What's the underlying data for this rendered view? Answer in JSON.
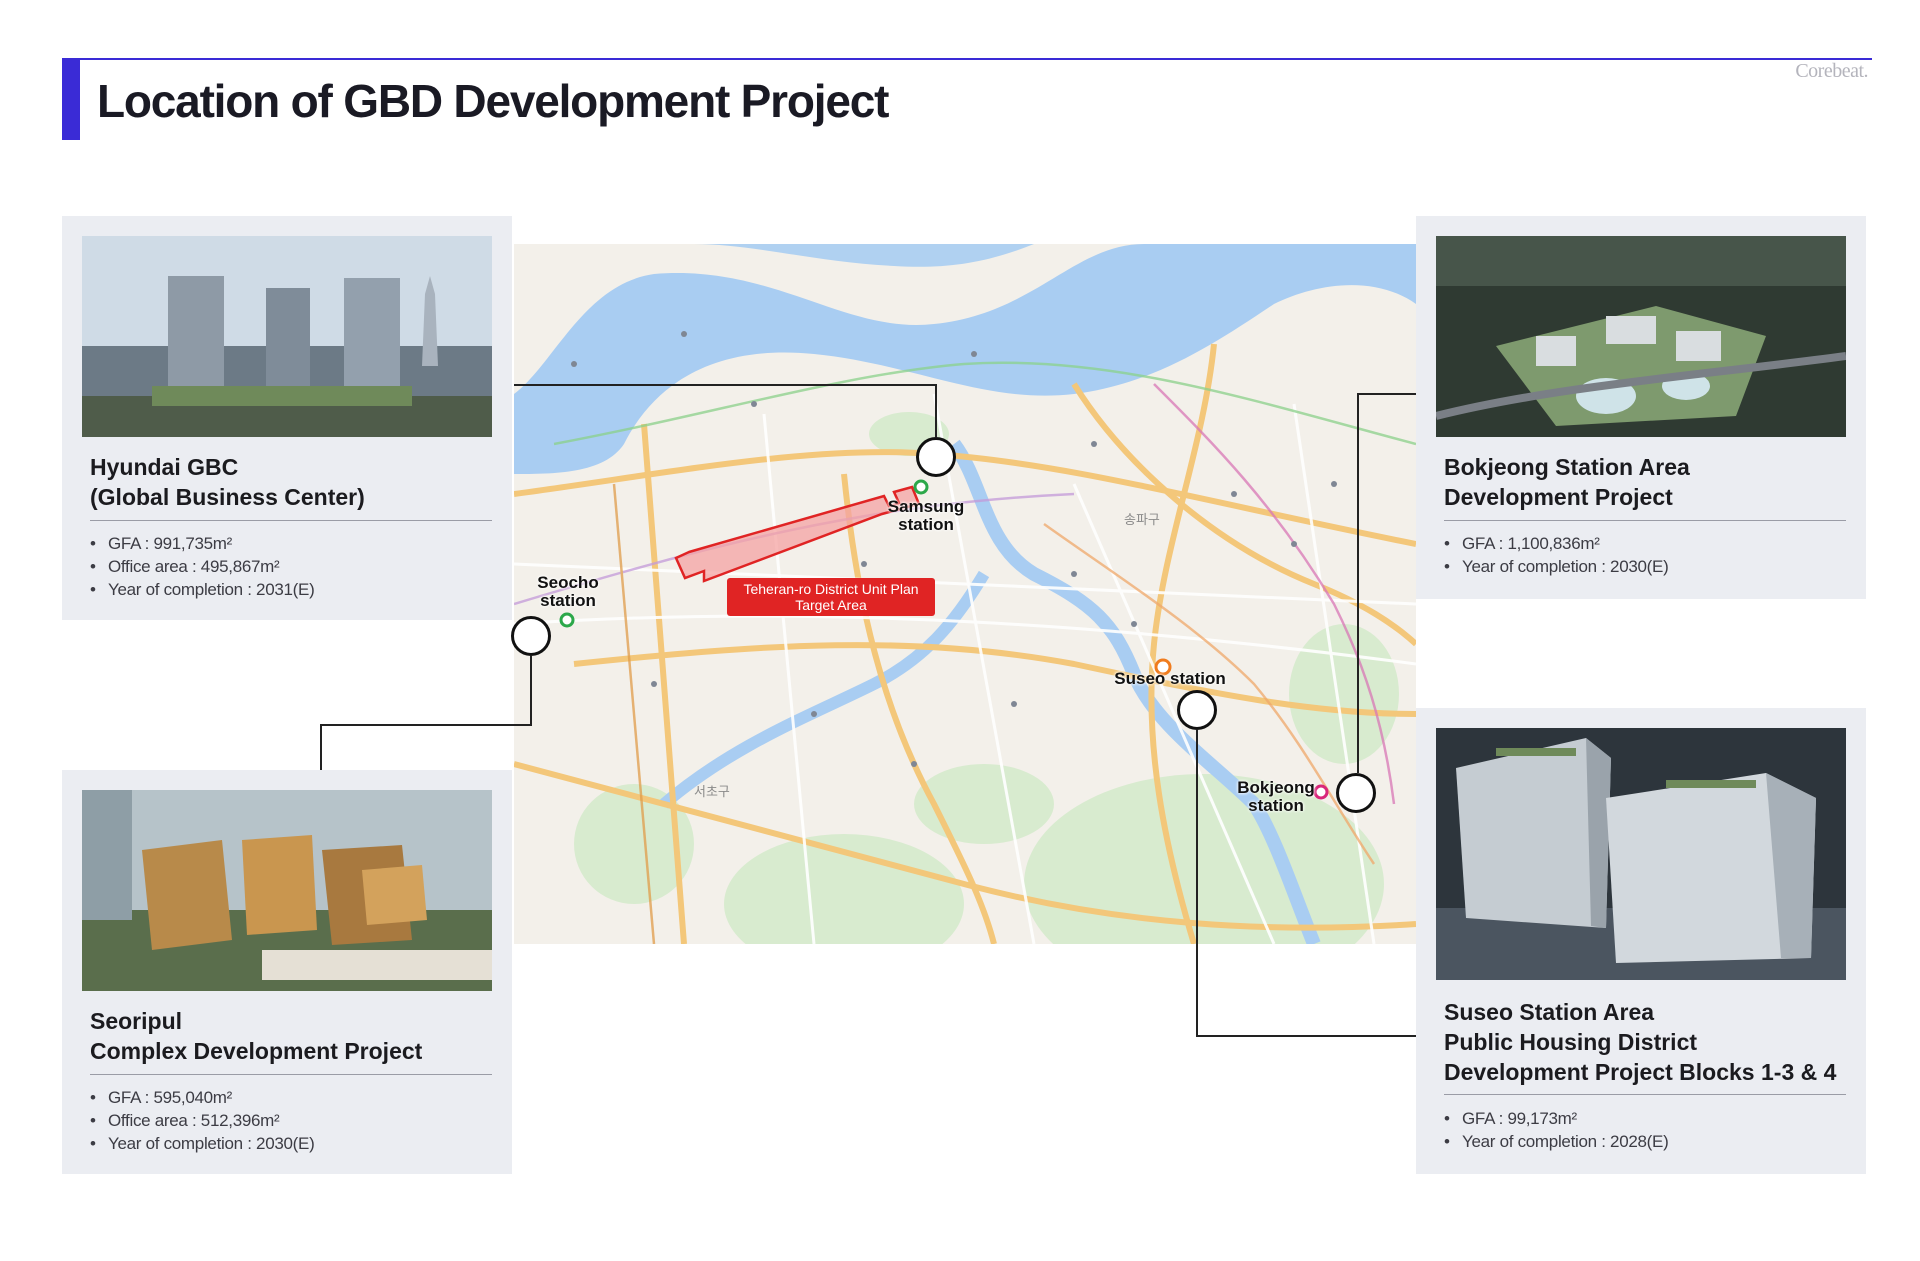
{
  "header": {
    "title": "Location of GBD Development Project",
    "brand": "Corebeat."
  },
  "projects": {
    "hyundai": {
      "title_lines": [
        "Hyundai GBC",
        "(Global Business Center)"
      ],
      "stats": [
        "GFA : 991,735m²",
        "Office area : 495,867m²",
        "Year of completion : 2031(E)"
      ]
    },
    "seoripul": {
      "title_lines": [
        "Seoripul",
        "Complex Development Project"
      ],
      "stats": [
        "GFA : 595,040m²",
        "Office area : 512,396m²",
        "Year of completion : 2030(E)"
      ]
    },
    "bokjeong": {
      "title_lines": [
        "Bokjeong Station Area",
        "Development Project"
      ],
      "stats": [
        "GFA : 1,100,836m²",
        "Year of completion : 2030(E)"
      ]
    },
    "suseo": {
      "title_lines": [
        "Suseo Station Area",
        "Public Housing District",
        "Development Project Blocks 1-3 & 4"
      ],
      "stats": [
        "GFA : 99,173m²",
        "Year of completion : 2028(E)"
      ]
    }
  },
  "map": {
    "stations": {
      "samsung": [
        "Samsung",
        "station"
      ],
      "seocho": [
        "Seocho",
        "station"
      ],
      "suseo": "Suseo station",
      "bokjeong": [
        "Bokjeong",
        "station"
      ]
    },
    "target_area": [
      "Teheran-ro District Unit Plan",
      "Target Area"
    ],
    "district_labels": [
      "송파구",
      "서초구"
    ],
    "colors": {
      "river": "#a9cdf2",
      "road_major": "#f3c77a",
      "target_fill": "#f4a3a3",
      "target_stroke": "#e02424",
      "accent": "#3a2bd6"
    }
  }
}
